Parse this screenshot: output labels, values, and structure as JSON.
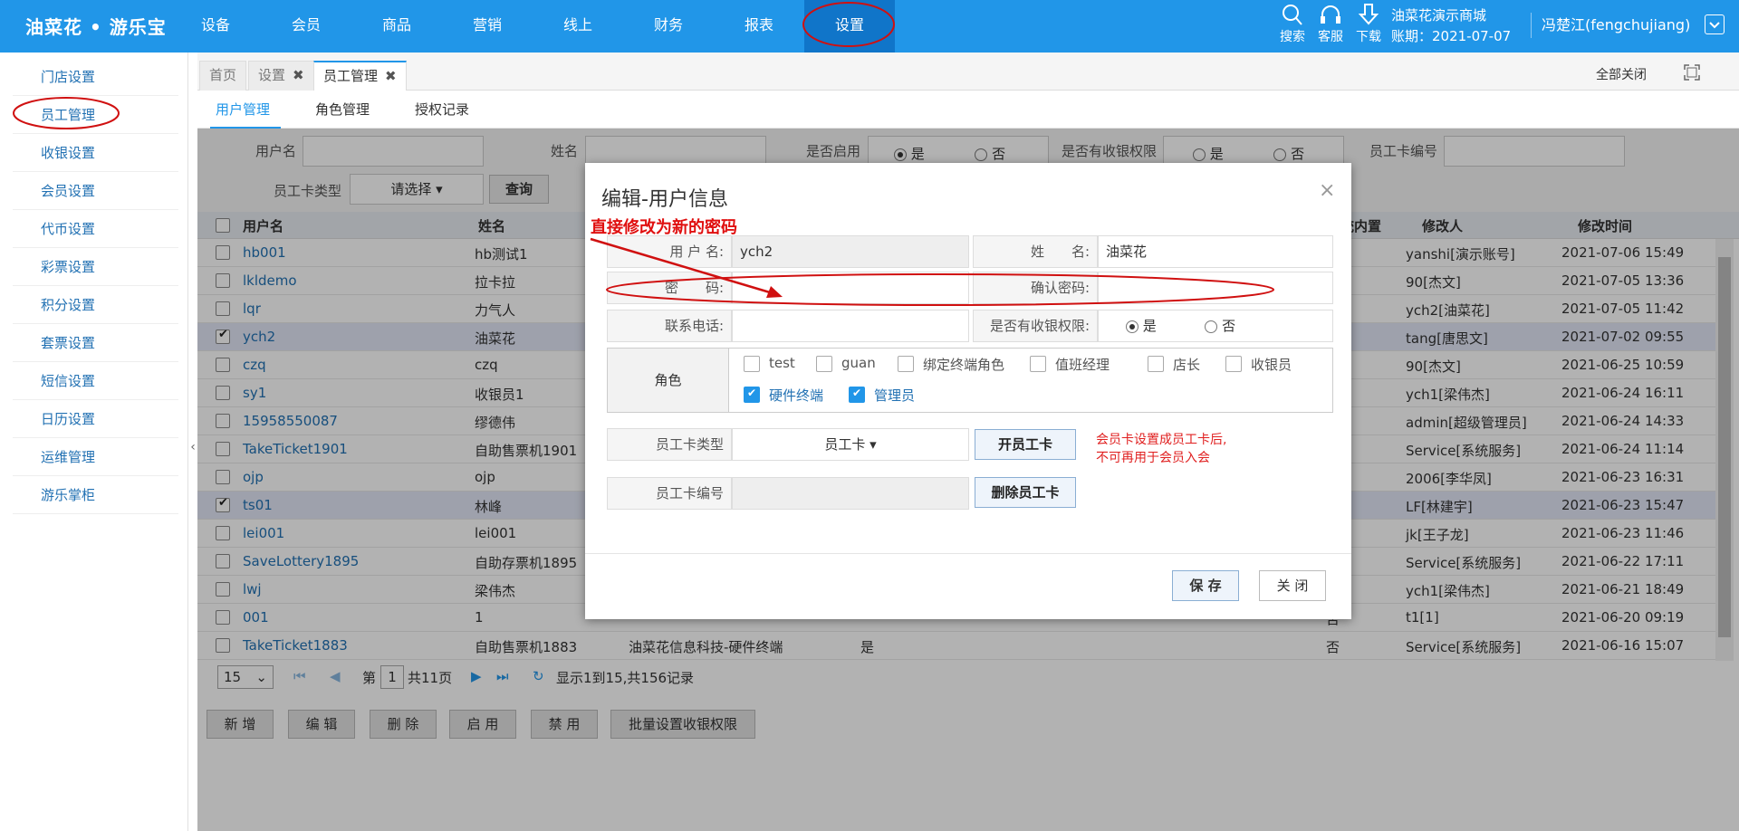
{
  "app": {
    "logo": "油菜花 • 游乐宝"
  },
  "nav": [
    "设备",
    "会员",
    "商品",
    "营销",
    "线上",
    "财务",
    "报表",
    "设置"
  ],
  "top_tools": [
    "搜索",
    "客服",
    "下载"
  ],
  "store": {
    "name": "油菜花演示商城",
    "period": "账期：2021-07-07"
  },
  "user": {
    "name": "冯楚江(fengchujiang)"
  },
  "sidebar": [
    "门店设置",
    "员工管理",
    "收银设置",
    "会员设置",
    "代币设置",
    "彩票设置",
    "积分设置",
    "套票设置",
    "短信设置",
    "日历设置",
    "运维管理",
    "游乐掌柜"
  ],
  "tabs": [
    {
      "label": "首页",
      "close": ""
    },
    {
      "label": "设置",
      "close": "✖"
    },
    {
      "label": "员工管理",
      "close": "✖"
    }
  ],
  "close_all": "全部关闭",
  "subtabs": [
    "用户管理",
    "角色管理",
    "授权记录"
  ],
  "filter": {
    "username_label": "用户名",
    "name_label": "姓名",
    "enabled_label": "是否启用",
    "yes": "是",
    "no": "否",
    "cashier_label": "是否有收银权限",
    "card_no_label": "员工卡编号",
    "card_type_label": "员工卡类型",
    "select_placeholder": "请选择",
    "query": "查询"
  },
  "table": {
    "headers": [
      "用户名",
      "姓名",
      "统内置",
      "修改人",
      "修改时间"
    ],
    "rows": [
      {
        "user": "hb001",
        "name": "hb测试1",
        "builtin": "",
        "modifier": "yanshi[演示账号]",
        "time": "2021-07-06 15:49",
        "checked": false
      },
      {
        "user": "lkldemo",
        "name": "拉卡拉",
        "builtin": "",
        "modifier": "90[杰文]",
        "time": "2021-07-05 13:36",
        "checked": false
      },
      {
        "user": "lqr",
        "name": "力气人",
        "builtin": "",
        "modifier": "ych2[油菜花]",
        "time": "2021-07-05 11:42",
        "checked": false
      },
      {
        "user": "ych2",
        "name": "油菜花",
        "builtin": "",
        "modifier": "tang[唐思文]",
        "time": "2021-07-02 09:55",
        "checked": true
      },
      {
        "user": "czq",
        "name": "czq",
        "builtin": "",
        "modifier": "90[杰文]",
        "time": "2021-06-25 10:59",
        "checked": false
      },
      {
        "user": "sy1",
        "name": "收银员1",
        "builtin": "",
        "modifier": "ych1[梁伟杰]",
        "time": "2021-06-24 16:11",
        "checked": false
      },
      {
        "user": "15958550087",
        "name": "缪德伟",
        "builtin": "",
        "modifier": "admin[超级管理员]",
        "time": "2021-06-24 14:33",
        "checked": false
      },
      {
        "user": "TakeTicket1901",
        "name": "自助售票机1901",
        "builtin": "",
        "modifier": "Service[系统服务]",
        "time": "2021-06-24 11:14",
        "checked": false
      },
      {
        "user": "ojp",
        "name": "ojp",
        "builtin": "",
        "modifier": "2006[李华凤]",
        "time": "2021-06-23 16:31",
        "checked": false
      },
      {
        "user": "ts01",
        "name": "林峰",
        "builtin": "",
        "modifier": "LF[林建宇]",
        "time": "2021-06-23 15:47",
        "checked": true
      },
      {
        "user": "lei001",
        "name": "lei001",
        "builtin": "",
        "modifier": "jk[王子龙]",
        "time": "2021-06-23 11:46",
        "checked": false
      },
      {
        "user": "SaveLottery1895",
        "name": "自助存票机1895",
        "builtin": "",
        "modifier": "Service[系统服务]",
        "time": "2021-06-22 17:11",
        "checked": false
      },
      {
        "user": "lwj",
        "name": "梁伟杰",
        "builtin": "",
        "modifier": "ych1[梁伟杰]",
        "time": "2021-06-21 18:49",
        "checked": false
      },
      {
        "user": "001",
        "name": "1",
        "builtin": "否",
        "modifier": "t1[1]",
        "time": "2021-06-20 09:19",
        "checked": false
      },
      {
        "user": "TakeTicket1883",
        "name": "自助售票机1883",
        "builtin": "否",
        "modifier": "Service[系统服务]",
        "time": "2021-06-16 15:07",
        "checked": false
      }
    ],
    "last_row_extra": {
      "org": "油菜花信息科技-硬件终端",
      "enabled": "是"
    }
  },
  "pager": {
    "size": "15",
    "page_prefix": "第",
    "page": "1",
    "page_suffix": "共11页",
    "summary": "显示1到15,共156记录"
  },
  "actions": [
    "新 增",
    "编 辑",
    "删 除",
    "启 用",
    "禁 用",
    "批量设置收银权限"
  ],
  "modal": {
    "title": "编辑-用户信息",
    "close": "×",
    "username_label": "用 户 名:",
    "username": "ych2",
    "name_label": "姓　　名:",
    "name": "油菜花",
    "password_label": "密　　码:",
    "password": "",
    "confirm_label": "确认密码:",
    "confirm": "",
    "phone_label": "联系电话:",
    "phone": "",
    "cashier_label": "是否有收银权限:",
    "yes": "是",
    "no": "否",
    "role_label": "角色",
    "roles": [
      {
        "label": "test",
        "checked": false
      },
      {
        "label": "guan",
        "checked": false
      },
      {
        "label": "绑定终端角色",
        "checked": false
      },
      {
        "label": "值班经理",
        "checked": false
      },
      {
        "label": "店长",
        "checked": false
      },
      {
        "label": "收银员",
        "checked": false
      },
      {
        "label": "硬件终端",
        "checked": true
      },
      {
        "label": "管理员",
        "checked": true
      }
    ],
    "card_type_label": "员工卡类型",
    "card_type": "员工卡",
    "open_card": "开员工卡",
    "note_line1": "会员卡设置成员工卡后,",
    "note_line2": "不可再用于会员入会",
    "card_no_label": "员工卡编号",
    "card_no": "",
    "delete_card": "删除员工卡",
    "save": "保 存",
    "close_btn": "关 闭"
  },
  "annotation": {
    "text": "直接修改为新的密码",
    "color": "#e01010"
  }
}
